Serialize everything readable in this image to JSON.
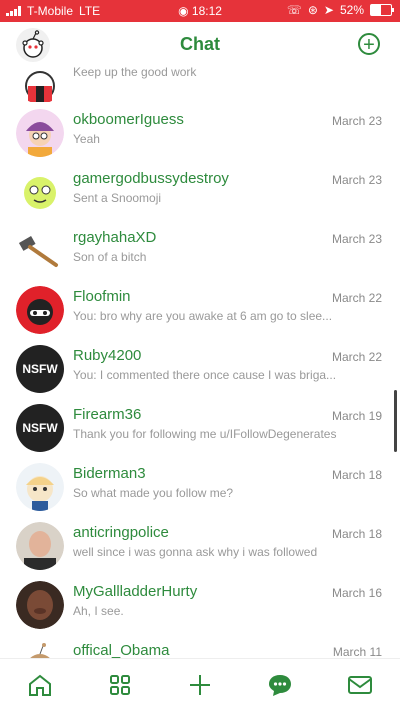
{
  "status": {
    "carrier": "T-Mobile",
    "network": "LTE",
    "time": "18:12",
    "battery": "52%",
    "battery_level": 0.52
  },
  "header": {
    "title": "Chat"
  },
  "chats": [
    {
      "name": "",
      "date": "",
      "message": "Keep up the good work",
      "avatar": "snoo-avatar"
    },
    {
      "name": "okboomerIguess",
      "date": "March 23",
      "message": "Yeah",
      "avatar": "avatar"
    },
    {
      "name": "gamergodbussydestroy",
      "date": "March 23",
      "message": "Sent a Snoomoji",
      "avatar": "avatar"
    },
    {
      "name": "rgayhahaXD",
      "date": "March 23",
      "message": "Son of a bitch",
      "avatar": "hammer"
    },
    {
      "name": "Floofmin",
      "date": "March 22",
      "message": "You: bro why are you awake at 6 am go to slee...",
      "avatar": "avatar"
    },
    {
      "name": "Ruby4200",
      "date": "March 22",
      "message": "You: I commented there once cause I was briga...",
      "avatar": "NSFW"
    },
    {
      "name": "Firearm36",
      "date": "March 19",
      "message": "Thank you for following me u/IFollowDegenerates",
      "avatar": "NSFW"
    },
    {
      "name": "Biderman3",
      "date": "March 18",
      "message": "So what made you follow me?",
      "avatar": "avatar"
    },
    {
      "name": "anticringpolice",
      "date": "March 18",
      "message": "well since i was gonna ask why i was followed",
      "avatar": "photo"
    },
    {
      "name": "MyGallladderHurty",
      "date": "March 16",
      "message": "Ah, I see.",
      "avatar": "photo"
    },
    {
      "name": "offical_Obama",
      "date": "March 11",
      "message": "",
      "avatar": "avatar"
    }
  ],
  "tabs": [
    "home-icon",
    "communities-icon",
    "create-icon",
    "chat-icon",
    "inbox-icon"
  ],
  "colors": {
    "accent": "#2e8b3d",
    "statusbar": "#e6333a"
  }
}
